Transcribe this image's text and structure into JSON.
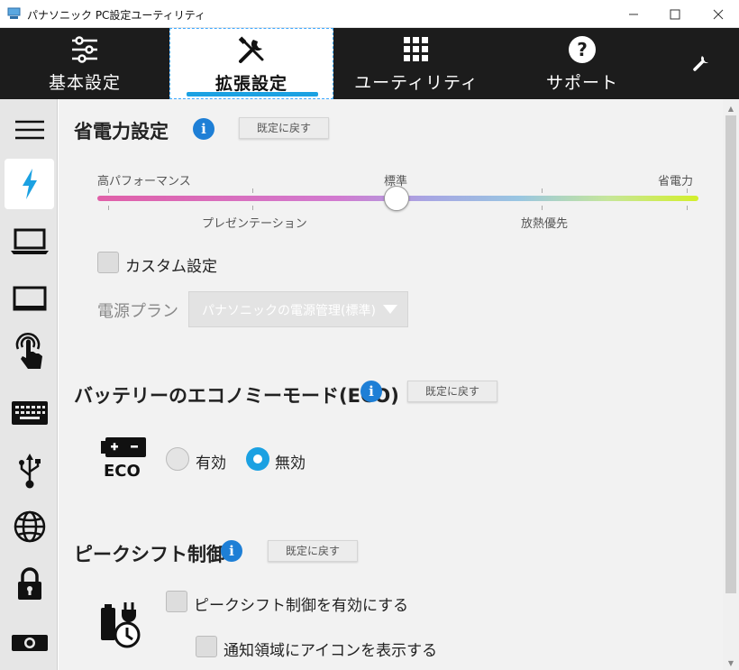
{
  "window": {
    "title": "パナソニック PC設定ユーティリティ"
  },
  "tabs": [
    {
      "label": "基本設定",
      "icon": "sliders-icon"
    },
    {
      "label": "拡張設定",
      "icon": "tools-icon"
    },
    {
      "label": "ユーティリティ",
      "icon": "grid-icon"
    },
    {
      "label": "サポート",
      "icon": "question-icon"
    },
    {
      "label": "",
      "icon": "wrench-icon"
    }
  ],
  "sidebar": [
    {
      "icon": "menu-icon"
    },
    {
      "icon": "power-icon",
      "active": true
    },
    {
      "icon": "laptop-icon"
    },
    {
      "icon": "display-icon"
    },
    {
      "icon": "touch-icon"
    },
    {
      "icon": "keyboard-icon"
    },
    {
      "icon": "usb-icon"
    },
    {
      "icon": "globe-icon"
    },
    {
      "icon": "lock-icon"
    },
    {
      "icon": "projector-icon"
    }
  ],
  "power": {
    "title": "省電力設定",
    "reset": "既定に戻す",
    "labels": {
      "high": "高パフォーマンス",
      "standard": "標準",
      "save": "省電力",
      "presentation": "プレゼンテーション",
      "cooling": "放熱優先"
    },
    "slider_value": "標準",
    "custom_label": "カスタム設定",
    "custom_checked": false,
    "plan_label": "電源プラン",
    "plan_value": "パナソニックの電源管理(標準)"
  },
  "eco": {
    "title": "バッテリーのエコノミーモード(ECO)",
    "reset": "既定に戻す",
    "icon_text": "ECO",
    "options": [
      "有効",
      "無効"
    ],
    "selected": "無効"
  },
  "peak": {
    "title": "ピークシフト制御",
    "reset": "既定に戻す",
    "enable_label": "ピークシフト制御を有効にする",
    "notify_label": "通知領域にアイコンを表示する"
  },
  "colors": {
    "accent": "#1ba1e2",
    "info": "#1e7fd6",
    "tabbar": "#1c1c1c"
  }
}
